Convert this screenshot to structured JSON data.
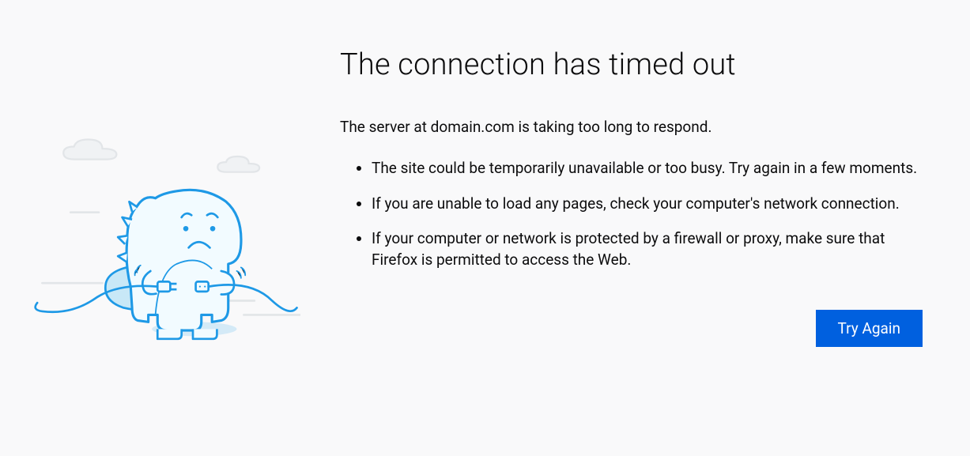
{
  "error": {
    "title": "The connection has timed out",
    "subtitle": "The server at domain.com is taking too long to respond.",
    "reasons": [
      "The site could be temporarily unavailable or too busy. Try again in a few moments.",
      "If you are unable to load any pages, check your computer's network connection.",
      "If your computer or network is protected by a firewall or proxy, make sure that Firefox is permitted to access the Web."
    ],
    "button_label": "Try Again"
  }
}
